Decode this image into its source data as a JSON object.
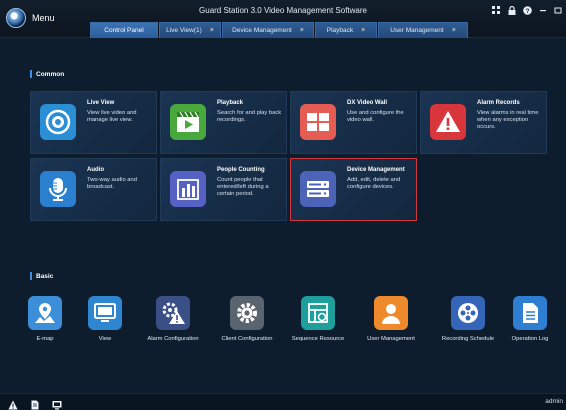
{
  "app": {
    "title": "Guard Station 3.0 Video Management Software",
    "menu_label": "Menu"
  },
  "tabs": [
    {
      "label": "Control Panel",
      "closable": false,
      "active": true
    },
    {
      "label": "Live View(1)",
      "closable": true,
      "active": false
    },
    {
      "label": "Device Management",
      "closable": true,
      "active": false
    },
    {
      "label": "Playback",
      "closable": true,
      "active": false
    },
    {
      "label": "User Management",
      "closable": true,
      "active": false
    }
  ],
  "tab_close_glyph": "×",
  "common": {
    "title": "Common",
    "cards": [
      {
        "title": "Live View",
        "desc": "View live video and manage live view.",
        "icon": "live-view-icon",
        "color": "#2b8fd6"
      },
      {
        "title": "Playback",
        "desc": "Search for and play back recordings.",
        "icon": "playback-icon",
        "color": "#49a83b"
      },
      {
        "title": "DX Video Wall",
        "desc": "Use and configure the video wall.",
        "icon": "video-wall-icon",
        "color": "#e45c52"
      },
      {
        "title": "Alarm Records",
        "desc": "View alarms in real time when any exception occurs.",
        "icon": "alarm-records-icon",
        "color": "#d9363c"
      },
      {
        "title": "Audio",
        "desc": "Two-way audio and broadcast.",
        "icon": "audio-icon",
        "color": "#2a7fcf"
      },
      {
        "title": "People Counting",
        "desc": "Count people that entered/left during a certain period.",
        "icon": "people-counting-icon",
        "color": "#5661c4"
      },
      {
        "title": "Device Management",
        "desc": "Add, edit, delete and configure devices.",
        "icon": "device-management-icon",
        "color": "#4c63b8",
        "selected": true
      }
    ]
  },
  "basic": {
    "title": "Basic",
    "items": [
      {
        "label": "E-map",
        "icon": "emap-icon",
        "color": "#3d8ed8"
      },
      {
        "label": "View",
        "icon": "view-icon",
        "color": "#2f86d0"
      },
      {
        "label": "Alarm Configuration",
        "icon": "alarm-config-icon",
        "color": "#3a4f86"
      },
      {
        "label": "Client Configuration",
        "icon": "client-config-icon",
        "color": "#5a6370"
      },
      {
        "label": "Sequence Resource",
        "icon": "sequence-resource-icon",
        "color": "#1f9f9c"
      },
      {
        "label": "User Management",
        "icon": "user-management-icon",
        "color": "#ee8a2c"
      },
      {
        "label": "Recording Schedule",
        "icon": "recording-schedule-icon",
        "color": "#3565b8"
      },
      {
        "label": "Operation Log",
        "icon": "operation-log-icon",
        "color": "#2e7fd2"
      }
    ]
  },
  "status": {
    "user": "admin",
    "icons": [
      "warning-icon",
      "document-icon",
      "monitor-icon"
    ]
  },
  "colors": {
    "accent": "#3d8de0",
    "selected_border": "#d2373c",
    "tab": "#2c5d99"
  }
}
